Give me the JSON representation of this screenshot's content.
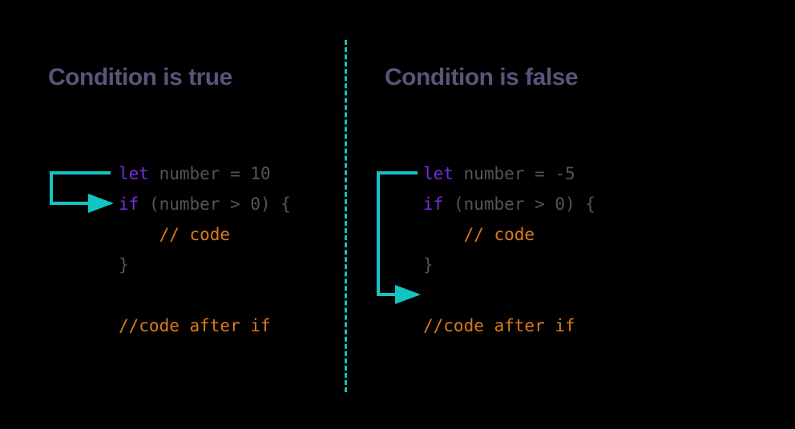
{
  "left": {
    "heading": "Condition is true",
    "code": {
      "l1_kw": "let",
      "l1_rest": " number = 10",
      "l2_kw": "if",
      "l2_rest": " (number > 0) {",
      "l3": "    // code",
      "l4": "}",
      "l5": "//code after if"
    }
  },
  "right": {
    "heading": "Condition is false",
    "code": {
      "l1_kw": "let",
      "l1_rest": " number = -5",
      "l2_kw": "if",
      "l2_rest": " (number > 0) {",
      "l3": "    // code",
      "l4": "}",
      "l5": "//code after if"
    }
  },
  "colors": {
    "arrow": "#12c4c4",
    "keyword": "#7a2be2",
    "text": "#555",
    "comment": "#dd7a1a",
    "heading": "#56567a"
  }
}
